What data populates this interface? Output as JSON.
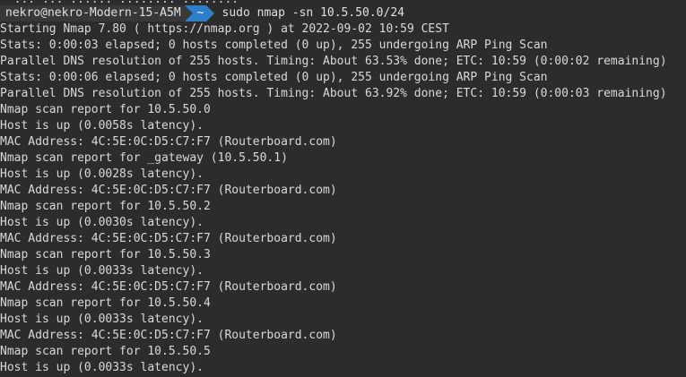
{
  "terminal": {
    "previous_line_cut": "  ... ... ...... ........ ........",
    "prompt": {
      "user_host": "nekro@nekro-Modern-15-A5M",
      "directory": "~",
      "command": "sudo nmap -sn 10.5.50.0/24"
    },
    "output_lines": [
      "Starting Nmap 7.80 ( https://nmap.org ) at 2022-09-02 10:59 CEST",
      "Stats: 0:00:03 elapsed; 0 hosts completed (0 up), 255 undergoing ARP Ping Scan",
      "Parallel DNS resolution of 255 hosts. Timing: About 63.53% done; ETC: 10:59 (0:00:02 remaining)",
      "Stats: 0:00:06 elapsed; 0 hosts completed (0 up), 255 undergoing ARP Ping Scan",
      "Parallel DNS resolution of 255 hosts. Timing: About 63.92% done; ETC: 10:59 (0:00:03 remaining)",
      "Nmap scan report for 10.5.50.0",
      "Host is up (0.0058s latency).",
      "MAC Address: 4C:5E:0C:D5:C7:F7 (Routerboard.com)",
      "Nmap scan report for _gateway (10.5.50.1)",
      "Host is up (0.0028s latency).",
      "MAC Address: 4C:5E:0C:D5:C7:F7 (Routerboard.com)",
      "Nmap scan report for 10.5.50.2",
      "Host is up (0.0030s latency).",
      "MAC Address: 4C:5E:0C:D5:C7:F7 (Routerboard.com)",
      "Nmap scan report for 10.5.50.3",
      "Host is up (0.0033s latency).",
      "MAC Address: 4C:5E:0C:D5:C7:F7 (Routerboard.com)",
      "Nmap scan report for 10.5.50.4",
      "Host is up (0.0033s latency).",
      "MAC Address: 4C:5E:0C:D5:C7:F7 (Routerboard.com)",
      "Nmap scan report for 10.5.50.5",
      "Host is up (0.0033s latency)."
    ]
  }
}
